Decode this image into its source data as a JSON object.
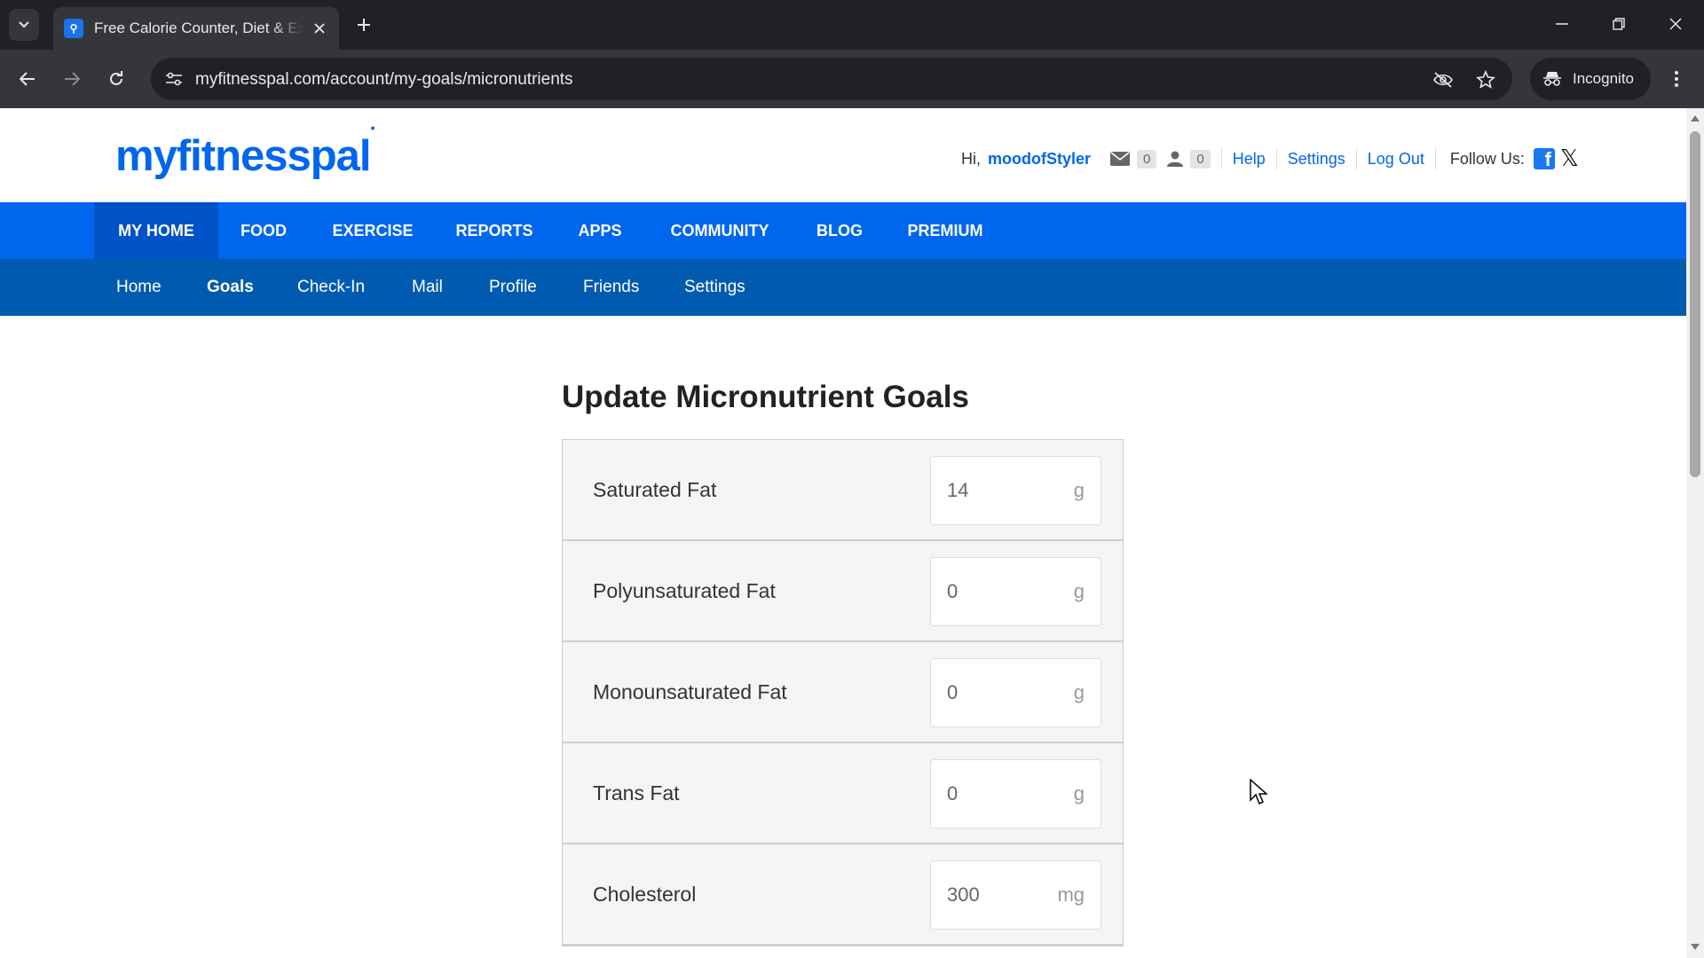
{
  "browser": {
    "tab_title": "Free Calorie Counter, Diet & Exercise",
    "url": "myfitnesspal.com/account/my-goals/micronutrients",
    "incognito_label": "Incognito"
  },
  "site": {
    "logo": "myfitnesspal",
    "greeting": "Hi,",
    "username": "moodofStyler",
    "mail_count": "0",
    "friend_count": "0",
    "help": "Help",
    "settings": "Settings",
    "logout": "Log Out",
    "follow": "Follow Us:"
  },
  "main_nav": [
    "MY HOME",
    "FOOD",
    "EXERCISE",
    "REPORTS",
    "APPS",
    "COMMUNITY",
    "BLOG",
    "PREMIUM"
  ],
  "sub_nav": [
    "Home",
    "Goals",
    "Check-In",
    "Mail",
    "Profile",
    "Friends",
    "Settings"
  ],
  "page": {
    "heading": "Update Micronutrient Goals"
  },
  "goals": [
    {
      "label": "Saturated Fat",
      "value": "14",
      "unit": "g"
    },
    {
      "label": "Polyunsaturated Fat",
      "value": "0",
      "unit": "g"
    },
    {
      "label": "Monounsaturated Fat",
      "value": "0",
      "unit": "g"
    },
    {
      "label": "Trans Fat",
      "value": "0",
      "unit": "g"
    },
    {
      "label": "Cholesterol",
      "value": "300",
      "unit": "mg"
    }
  ],
  "colors": {
    "brand_blue": "#0066ee",
    "subnav_blue": "#005bb0"
  }
}
